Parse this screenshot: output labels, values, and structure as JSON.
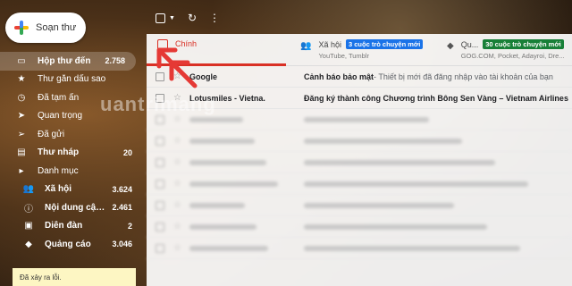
{
  "compose": {
    "label": "Soạn thư"
  },
  "nav": [
    {
      "icon": "inbox-icon",
      "glyph": "▭",
      "label": "Hộp thư đến",
      "count": "2.758",
      "active": true,
      "bold": true
    },
    {
      "icon": "star-icon",
      "glyph": "★",
      "label": "Thư gắn dấu sao",
      "count": "",
      "active": false,
      "bold": false
    },
    {
      "icon": "clock-icon",
      "glyph": "◷",
      "label": "Đã tạm ẩn",
      "count": "",
      "active": false,
      "bold": false
    },
    {
      "icon": "important-icon",
      "glyph": "➤",
      "label": "Quan trọng",
      "count": "",
      "active": false,
      "bold": false
    },
    {
      "icon": "send-icon",
      "glyph": "➢",
      "label": "Đã gửi",
      "count": "",
      "active": false,
      "bold": false
    },
    {
      "icon": "draft-icon",
      "glyph": "▤",
      "label": "Thư nháp",
      "count": "20",
      "active": false,
      "bold": true
    },
    {
      "icon": "category-icon",
      "glyph": "▸",
      "label": "Danh mục",
      "count": "",
      "active": false,
      "bold": false
    },
    {
      "icon": "people-icon",
      "glyph": "👥",
      "label": "Xã hội",
      "count": "3.624",
      "active": false,
      "bold": true,
      "sub": true
    },
    {
      "icon": "info-icon",
      "glyph": "ⓘ",
      "label": "Nội dung cập ...",
      "count": "2.461",
      "active": false,
      "bold": true,
      "sub": true
    },
    {
      "icon": "forum-icon",
      "glyph": "▣",
      "label": "Diễn đàn",
      "count": "2",
      "active": false,
      "bold": true,
      "sub": true
    },
    {
      "icon": "tag-icon",
      "glyph": "◆",
      "label": "Quảng cáo",
      "count": "3.046",
      "active": false,
      "bold": true,
      "sub": true
    }
  ],
  "error": {
    "text": "Đã xảy ra lỗi."
  },
  "tabs": {
    "main": {
      "label": "Chính"
    },
    "social": {
      "label": "Xã hội",
      "badge": "3 cuộc trò chuyện mới",
      "sub": "YouTube, Tumblr"
    },
    "promo": {
      "label": "Qu...",
      "badge": "30 cuộc trò chuyện mới",
      "sub": "GOG.COM, Pocket, Adayroi, Dre..."
    }
  },
  "emails": [
    {
      "sender": "Google",
      "subject": "Cảnh báo bảo mật",
      "snippet": " - Thiết bị mới đã đăng nhập vào tài khoản của bạn"
    },
    {
      "sender": "Lotusmiles - Vietna.",
      "subject": "Đăng ký thành công Chương trình Bông Sen Vàng – Vietnam Airlines",
      "snippet": ""
    }
  ],
  "blurred_rows": 7,
  "watermark": {
    "text": "uantrimang"
  },
  "colors": {
    "accent": "#d93025",
    "badge_blue": "#1a73e8",
    "badge_green": "#188038"
  }
}
